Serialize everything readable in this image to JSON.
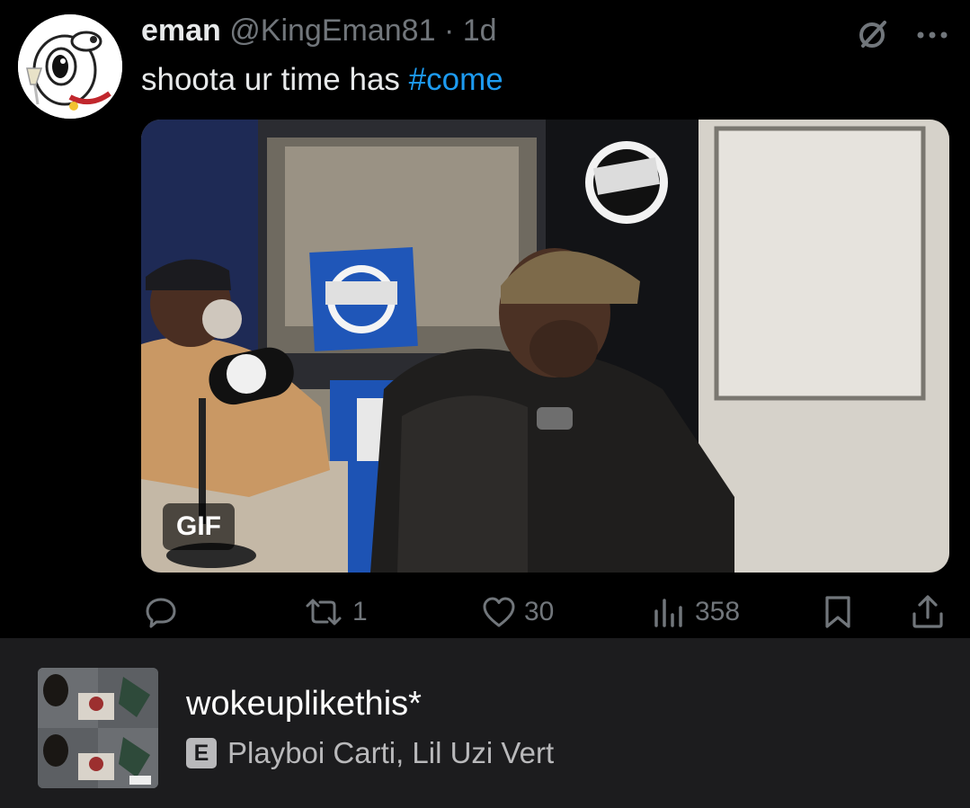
{
  "tweet": {
    "author_name": "eman",
    "author_handle": "@KingEman81",
    "separator": "·",
    "time": "1d",
    "text": "shoota ur time has ",
    "hashtag": "#come",
    "avatar_icon": "cartoon-dog-avatar",
    "media": {
      "badge": "GIF",
      "description_icon": "studio-interview-gif"
    },
    "top_icons": [
      "grok-icon",
      "more-icon"
    ],
    "actions": {
      "reply": {
        "icon": "reply-icon",
        "count": ""
      },
      "retweet": {
        "icon": "retweet-icon",
        "count": "1"
      },
      "like": {
        "icon": "heart-icon",
        "count": "30"
      },
      "views": {
        "icon": "views-icon",
        "count": "358"
      },
      "bookmark": {
        "icon": "bookmark-icon"
      },
      "share": {
        "icon": "share-icon"
      }
    }
  },
  "player": {
    "track_title": "wokeuplikethis*",
    "explicit_badge": "E",
    "artists": "Playboi Carti, Lil Uzi Vert",
    "cover_icon": "album-cover-art"
  },
  "colors": {
    "background": "#000000",
    "text": "#e7e9ea",
    "muted": "#71767b",
    "accent": "#1d9bf0",
    "player_bg": "#1c1c1e"
  }
}
